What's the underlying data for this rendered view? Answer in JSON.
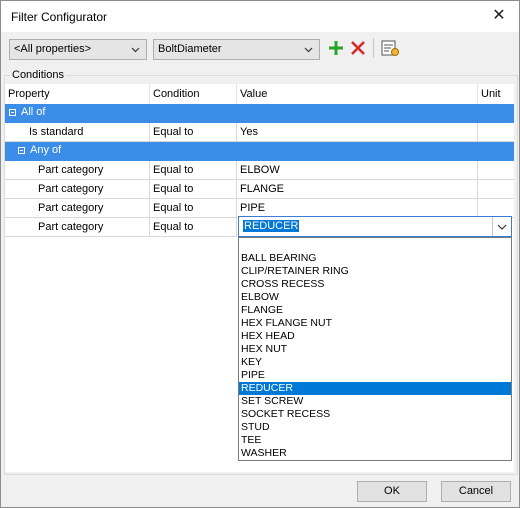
{
  "window": {
    "title": "Filter Configurator"
  },
  "toolbar": {
    "property_filter": "<All properties>",
    "property_select": "BoltDiameter",
    "add_icon": "plus-icon",
    "remove_icon": "delete-x-icon",
    "view_icon": "filter-settings-icon"
  },
  "conditions": {
    "label": "Conditions",
    "columns": [
      "Property",
      "Condition",
      "Value",
      "Unit"
    ],
    "groups": [
      {
        "label": "All of"
      },
      {
        "label": "Any of"
      }
    ],
    "rows": [
      {
        "property": "Is standard",
        "condition": "Equal to",
        "value": "Yes"
      },
      {
        "property": "Part category",
        "condition": "Equal to",
        "value": "ELBOW"
      },
      {
        "property": "Part category",
        "condition": "Equal to",
        "value": "FLANGE"
      },
      {
        "property": "Part category",
        "condition": "Equal to",
        "value": "PIPE"
      },
      {
        "property": "Part category",
        "condition": "Equal to",
        "value": "REDUCER"
      }
    ]
  },
  "dropdown": {
    "current": "REDUCER",
    "options": [
      "",
      "BALL BEARING",
      "CLIP/RETAINER RING",
      "CROSS RECESS",
      "ELBOW",
      "FLANGE",
      "HEX FLANGE NUT",
      "HEX HEAD",
      "HEX NUT",
      "KEY",
      "PIPE",
      "REDUCER",
      "SET SCREW",
      "SOCKET RECESS",
      "STUD",
      "TEE",
      "WASHER"
    ],
    "selected_index": 11
  },
  "footer": {
    "ok_label": "OK",
    "cancel_label": "Cancel"
  },
  "colors": {
    "group_row": "#3c8de8",
    "selection": "#0078d7",
    "add": "#2aa52a",
    "remove": "#d42a2a"
  }
}
